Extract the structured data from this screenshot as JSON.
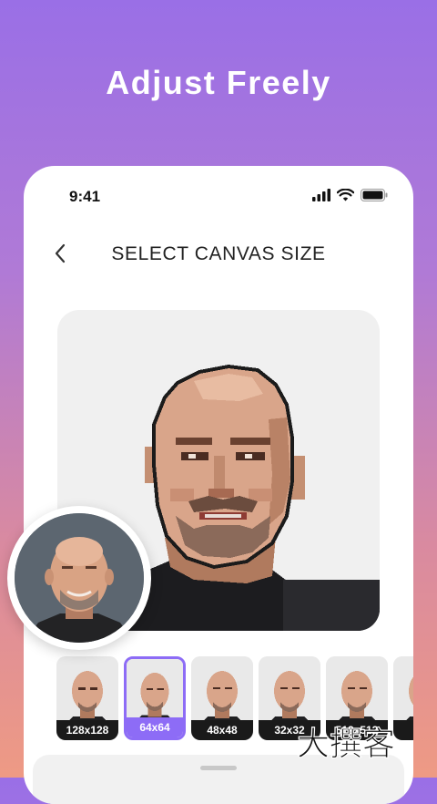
{
  "headline": "Adjust Freely",
  "status_bar": {
    "time": "9:41",
    "icons": [
      "signal-icon",
      "wifi-icon",
      "battery-icon"
    ]
  },
  "screen": {
    "title": "SELECT CANVAS SIZE",
    "back_icon": "chevron-left-icon"
  },
  "canvas_sizes": [
    {
      "label": "128x128",
      "selected": false
    },
    {
      "label": "64x64",
      "selected": true
    },
    {
      "label": "48x48",
      "selected": false
    },
    {
      "label": "32x32",
      "selected": false
    },
    {
      "label": "512x512",
      "selected": false
    },
    {
      "label": "",
      "selected": false
    }
  ],
  "colors": {
    "accent": "#8d6cf6",
    "label_bg": "#1a1a1a"
  },
  "watermark": {
    "text": "大撰客"
  }
}
